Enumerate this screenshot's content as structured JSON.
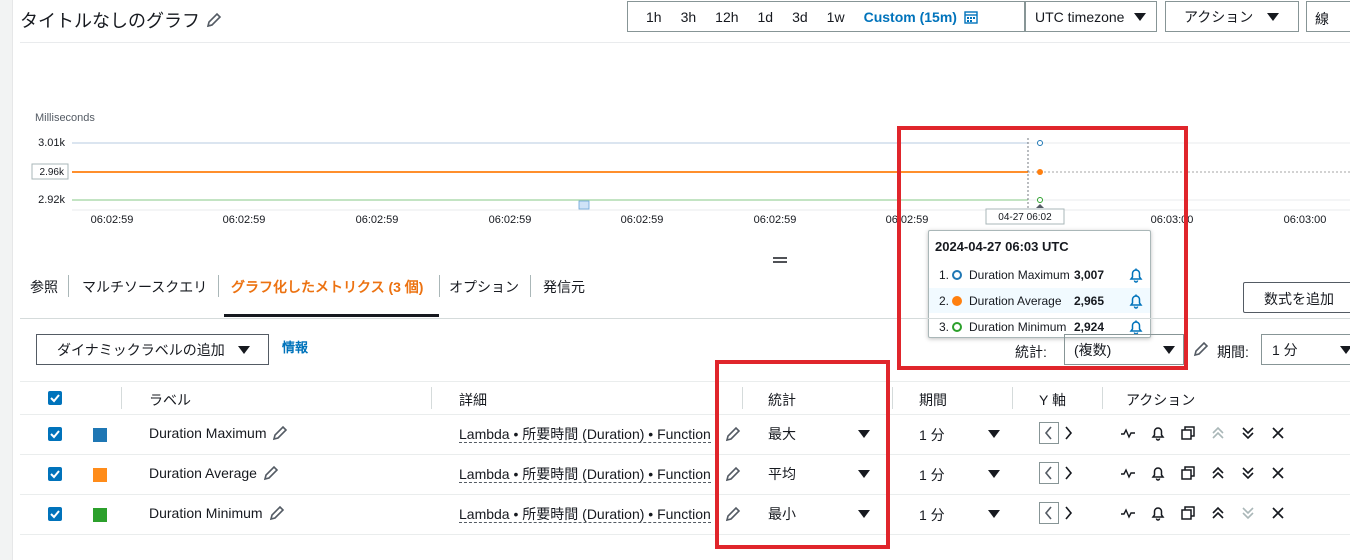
{
  "header": {
    "title": "タイトルなしのグラフ",
    "time_ranges": [
      "1h",
      "3h",
      "12h",
      "1d",
      "3d",
      "1w"
    ],
    "custom_range": "Custom (15m)",
    "timezone": "UTC timezone",
    "actions": "アクション",
    "view_type": "線"
  },
  "chart": {
    "unit_label": "Milliseconds",
    "y_ticks": [
      "3.01k",
      "2.96k",
      "2.92k"
    ],
    "x_ticks": [
      "06:02:59",
      "06:02:59",
      "06:02:59",
      "06:02:59",
      "06:02:59",
      "06:02:59",
      "06:02:59",
      "06:03:00",
      "06:03:00"
    ],
    "cursor_label": "04-27 06:02",
    "colors": {
      "maximum": "#1f77b4",
      "average": "#ff7f0e",
      "minimum": "#2ca02c"
    }
  },
  "tooltip": {
    "title": "2024-04-27 06:03 UTC",
    "rows": [
      {
        "index": "1.",
        "name": "Duration Maximum",
        "value": "3,007",
        "color": "#1f77b4",
        "style": "hollow"
      },
      {
        "index": "2.",
        "name": "Duration Average",
        "value": "2,965",
        "color": "#ff7f0e",
        "style": "filled"
      },
      {
        "index": "3.",
        "name": "Duration Minimum",
        "value": "2,924",
        "color": "#2ca02c",
        "style": "hollow"
      }
    ]
  },
  "tabs": [
    {
      "label": "参照",
      "active": false
    },
    {
      "label": "マルチソースクエリ",
      "active": false
    },
    {
      "label": "グラフ化したメトリクス (3 個)",
      "active": true
    },
    {
      "label": "オプション",
      "active": false
    },
    {
      "label": "発信元",
      "active": false
    }
  ],
  "toolbar": {
    "add_math": "数式を追加",
    "dynamic_label": "ダイナミックラベルの追加",
    "info": "情報",
    "statistic_label": "統計:",
    "statistic_value": "(複数)",
    "period_label": "期間:",
    "period_value": "1 分"
  },
  "table": {
    "headers": {
      "label": "ラベル",
      "details": "詳細",
      "statistic": "統計",
      "period": "期間",
      "yaxis": "Y 軸",
      "actions": "アクション"
    },
    "rows": [
      {
        "label": "Duration Maximum",
        "color": "#1f77b4",
        "details": "Lambda • 所要時間 (Duration) • Function",
        "statistic": "最大",
        "period": "1 分"
      },
      {
        "label": "Duration Average",
        "color": "#ff8c1a",
        "details": "Lambda • 所要時間 (Duration) • Function",
        "statistic": "平均",
        "period": "1 分"
      },
      {
        "label": "Duration Minimum",
        "color": "#2ca02c",
        "details": "Lambda • 所要時間 (Duration) • Function",
        "statistic": "最小",
        "period": "1 分"
      }
    ]
  }
}
